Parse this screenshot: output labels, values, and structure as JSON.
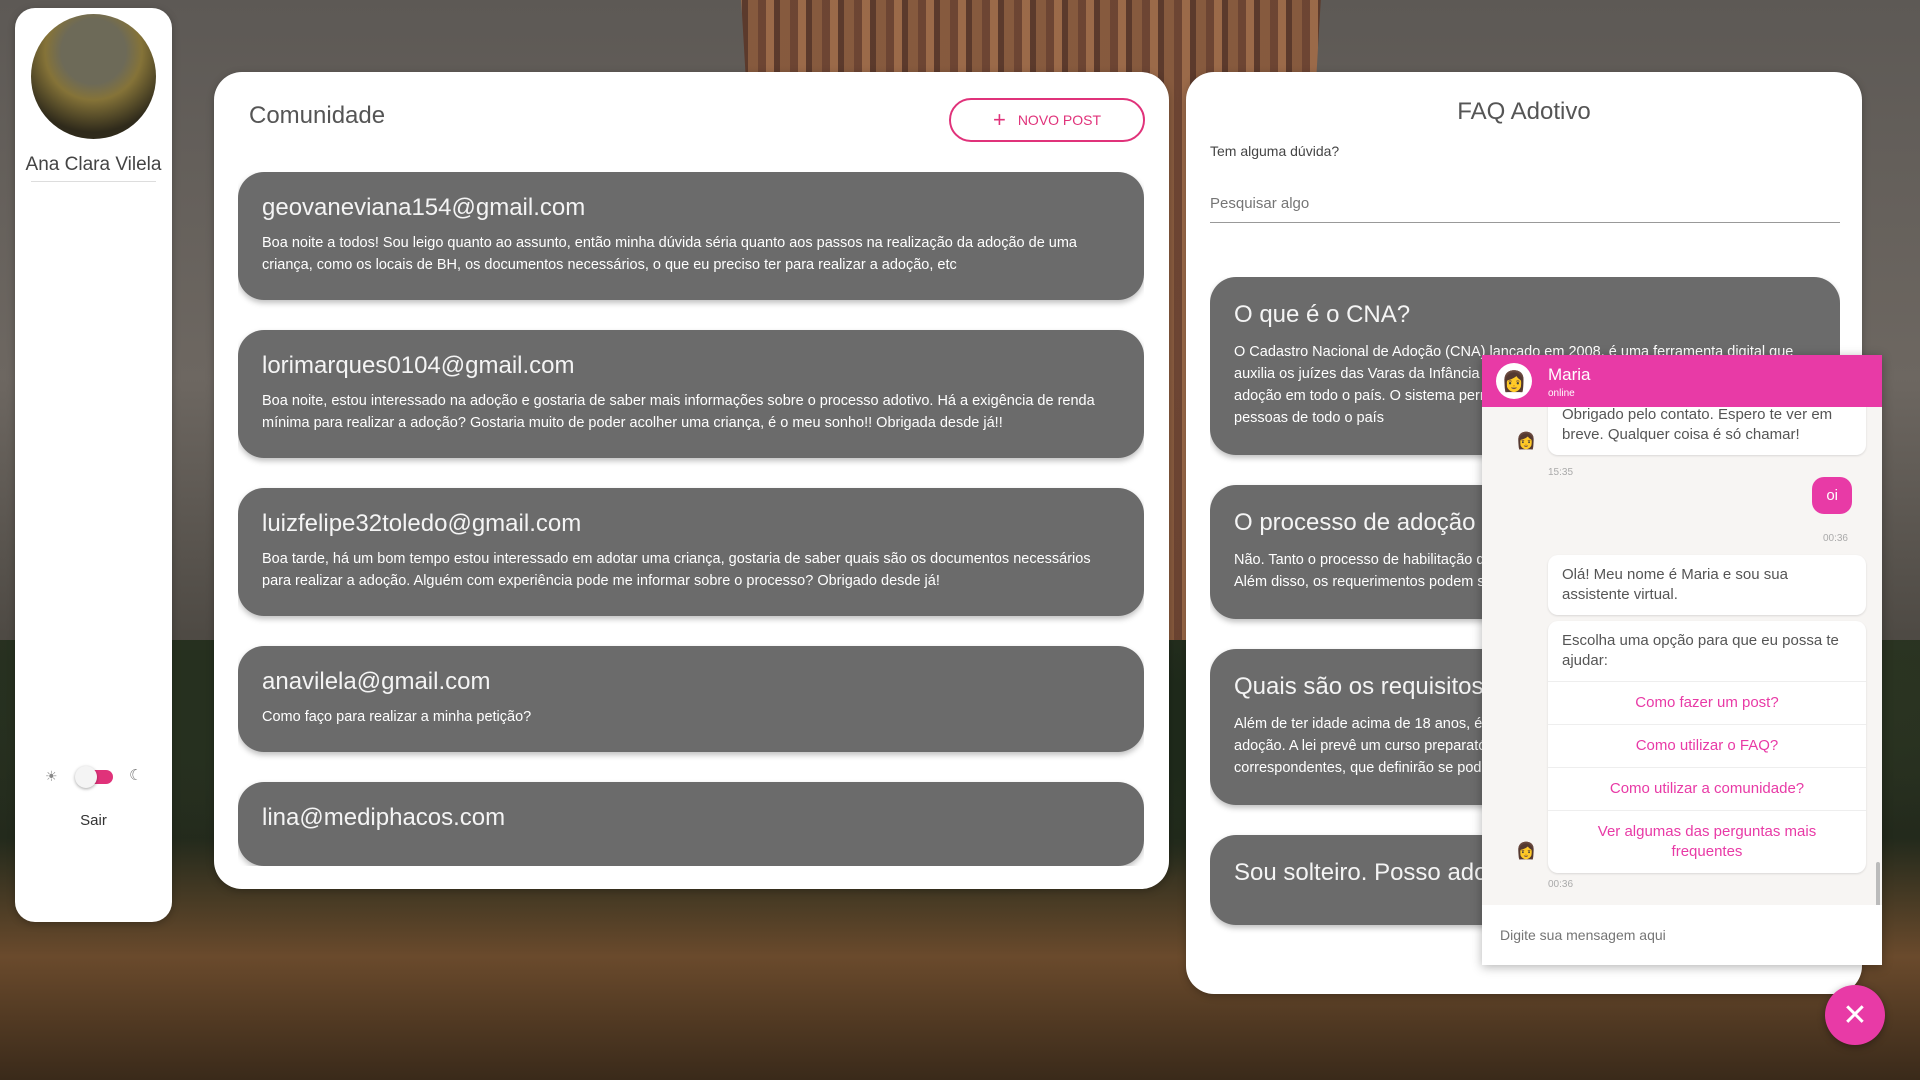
{
  "sidebar": {
    "user_name": "Ana Clara Vilela",
    "logout_label": "Sair",
    "theme_toggle": {
      "state": "on",
      "left_icon": "sun-icon",
      "right_icon": "moon-icon"
    }
  },
  "community": {
    "title": "Comunidade",
    "new_post_label": "NOVO POST",
    "posts": [
      {
        "email": "geovaneviana154@gmail.com",
        "body": "Boa noite a todos! Sou leigo quanto ao assunto, então minha dúvida séria quanto aos passos na realização da adoção de uma criança, como os locais de BH, os documentos necessários, o que eu preciso ter para realizar a adoção, etc"
      },
      {
        "email": "lorimarques0104@gmail.com",
        "body": "Boa noite, estou interessado na adoção e gostaria de saber mais informações sobre o processo adotivo. Há a exigência de renda mínima para realizar a adoção? Gostaria muito de poder acolher uma criança, é o meu sonho!! Obrigada desde já!!"
      },
      {
        "email": "luizfelipe32toledo@gmail.com",
        "body": "Boa tarde, há um bom tempo estou interessado em adotar uma criança, gostaria de saber quais são os documentos necessários para realizar a adoção. Alguém com experiência pode me informar sobre o processo? Obrigado desde já!"
      },
      {
        "email": "anavilela@gmail.com",
        "body": "Como faço para realizar a minha petição?"
      },
      {
        "email": "lina@mediphacos.com",
        "body": ""
      }
    ]
  },
  "faq": {
    "title": "FAQ Adotivo",
    "question_label": "Tem alguma dúvida?",
    "search_placeholder": "Pesquisar algo",
    "items": [
      {
        "q": "O que é o CNA?",
        "a": "O Cadastro Nacional de Adoção (CNA) lançado em 2008, é uma ferramenta digital que auxilia os juízes das Varas da Infância e da Juventude na condução dos processos de adoção em todo o país. O sistema permite a aproximação entre os abrigos brasileiros e pessoas de todo o país"
      },
      {
        "q": "O processo de adoção tem custo?",
        "a": "Não. Tanto o processo de habilitação quanto o de adoção são isentos de custas judiciais. Além disso, os requerimentos podem ser formulados sem advogado."
      },
      {
        "q": "Quais são os requisitos para adotar?",
        "a": "Além de ter idade acima de 18 anos, é preciso apresentar motivação idônea para a adoção. A lei prevê um curso preparatório para adoção, onde serão feitas as avaliações correspondentes, que definirão se podem adotar."
      },
      {
        "q": "Sou solteiro. Posso adotar?",
        "a": ""
      }
    ]
  },
  "chat": {
    "agent_name": "Maria",
    "agent_status": "online",
    "messages": {
      "bot_farewell": "Obrigado pelo contato. Espero te ver em breve. Qualquer coisa é só chamar!",
      "bot_farewell_time": "15:35",
      "user_msg": "oi",
      "user_msg_time": "00:36",
      "bot_greeting": "Olá! Meu nome é Maria e sou sua assistente virtual.",
      "bot_options_prompt": "Escolha uma opção para que eu possa te ajudar:",
      "options": [
        "Como fazer um post?",
        "Como utilizar o FAQ?",
        "Como utilizar a comunidade?",
        "Ver algumas das perguntas mais frequentes"
      ],
      "bot_options_time": "00:36"
    },
    "input_placeholder": "Digite sua mensagem aqui",
    "close_label": "✕"
  },
  "colors": {
    "accent": "#e0327a",
    "chat_accent": "#e83aa6",
    "card": "#6b6b6b"
  }
}
